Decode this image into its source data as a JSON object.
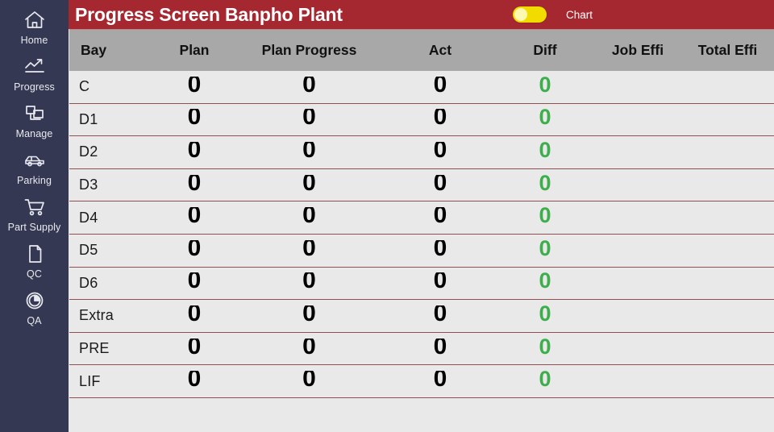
{
  "sidebar": {
    "items": [
      {
        "label": "Home",
        "icon": "home-icon"
      },
      {
        "label": "Progress",
        "icon": "trend-up-icon"
      },
      {
        "label": "Manage",
        "icon": "devices-icon"
      },
      {
        "label": "Parking",
        "icon": "car-icon"
      },
      {
        "label": "Part Supply",
        "icon": "shopping-cart-icon"
      },
      {
        "label": "QC",
        "icon": "document-icon"
      },
      {
        "label": "QA",
        "icon": "pie-chart-icon"
      }
    ]
  },
  "header": {
    "title": "Progress Screen Banpho Plant",
    "toggle_label": "Chart",
    "toggle_on": true,
    "bg_color": "#A52831",
    "toggle_color": "#F2DC00"
  },
  "table": {
    "columns": [
      "Bay",
      "Plan",
      "Plan Progress",
      "Act",
      "Diff",
      "Job Effi",
      "Total Effi"
    ],
    "header_bg": "#A8A8A8",
    "row_bg": "#E9E9E9",
    "diff_color": "#3DAE4B",
    "divider_color": "#8E5050",
    "rows": [
      {
        "bay": "C",
        "plan": "0",
        "plan_progress": "0",
        "act": "0",
        "diff": "0",
        "job_effi": "",
        "total_effi": ""
      },
      {
        "bay": "D1",
        "plan": "0",
        "plan_progress": "0",
        "act": "0",
        "diff": "0",
        "job_effi": "",
        "total_effi": ""
      },
      {
        "bay": "D2",
        "plan": "0",
        "plan_progress": "0",
        "act": "0",
        "diff": "0",
        "job_effi": "",
        "total_effi": ""
      },
      {
        "bay": "D3",
        "plan": "0",
        "plan_progress": "0",
        "act": "0",
        "diff": "0",
        "job_effi": "",
        "total_effi": ""
      },
      {
        "bay": "D4",
        "plan": "0",
        "plan_progress": "0",
        "act": "0",
        "diff": "0",
        "job_effi": "",
        "total_effi": ""
      },
      {
        "bay": "D5",
        "plan": "0",
        "plan_progress": "0",
        "act": "0",
        "diff": "0",
        "job_effi": "",
        "total_effi": ""
      },
      {
        "bay": "D6",
        "plan": "0",
        "plan_progress": "0",
        "act": "0",
        "diff": "0",
        "job_effi": "",
        "total_effi": ""
      },
      {
        "bay": "Extra",
        "plan": "0",
        "plan_progress": "0",
        "act": "0",
        "diff": "0",
        "job_effi": "",
        "total_effi": ""
      },
      {
        "bay": "PRE",
        "plan": "0",
        "plan_progress": "0",
        "act": "0",
        "diff": "0",
        "job_effi": "",
        "total_effi": ""
      },
      {
        "bay": "LIF",
        "plan": "0",
        "plan_progress": "0",
        "act": "0",
        "diff": "0",
        "job_effi": "",
        "total_effi": ""
      }
    ]
  }
}
